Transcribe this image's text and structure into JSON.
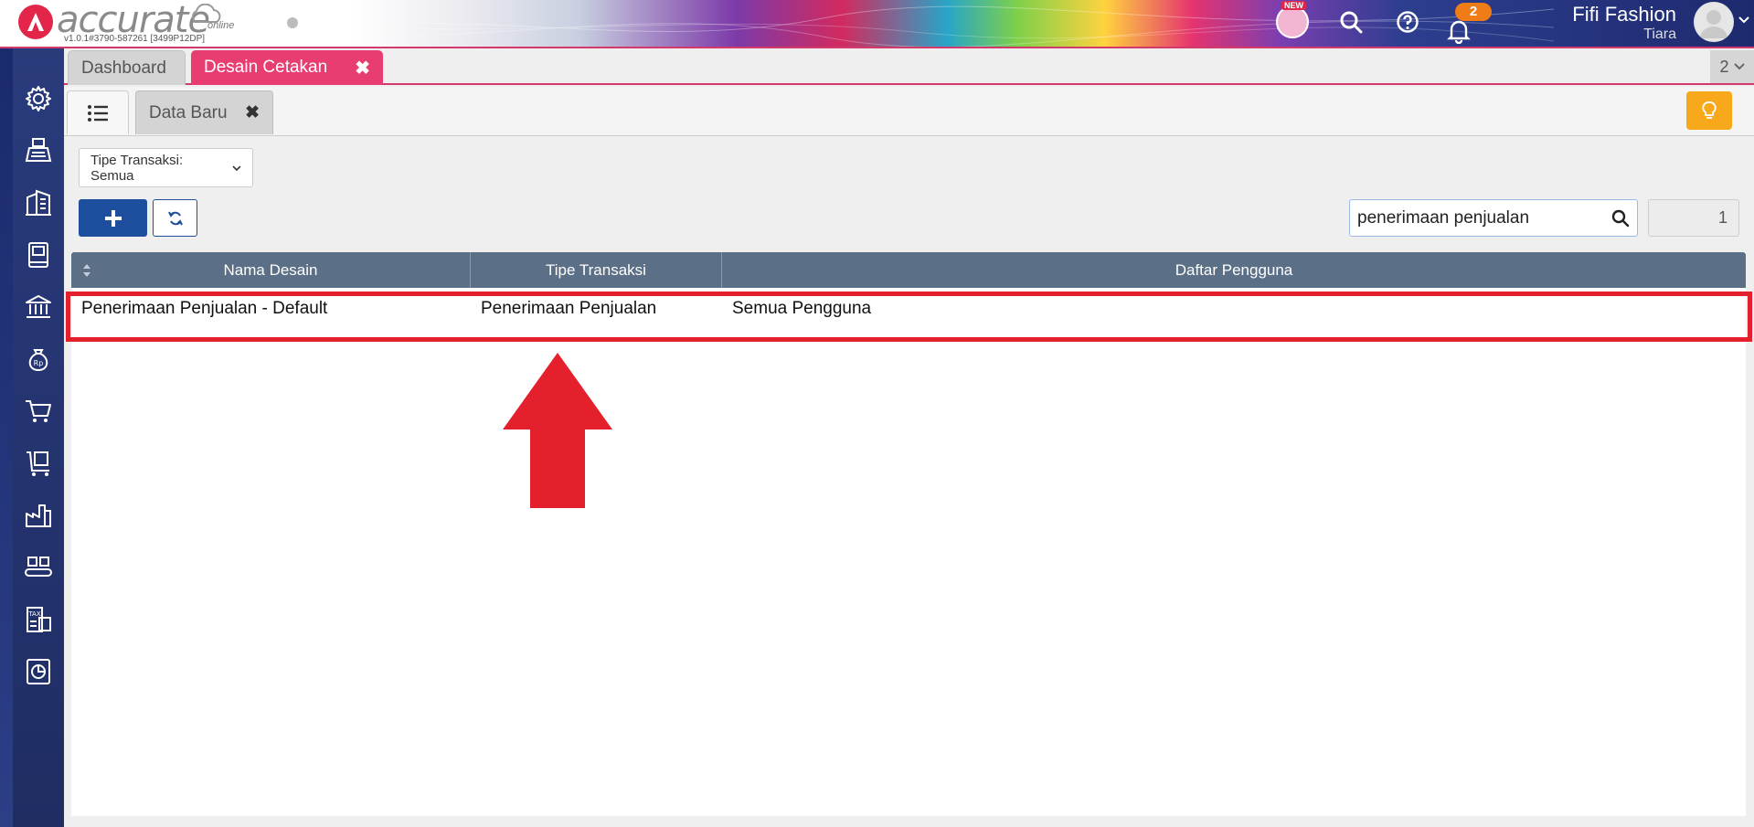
{
  "header": {
    "logo_text": "accurate",
    "logo_suffix": "online",
    "version": "v1.0.1#3790-587261 [3499P12DP]",
    "new_badge": "NEW",
    "notification_count": "2",
    "company_name": "Fifi Fashion",
    "user_name": "Tiara"
  },
  "tabs": [
    {
      "label": "Dashboard"
    },
    {
      "label": "Desain Cetakan",
      "active": true,
      "close": "✖"
    }
  ],
  "tab_count": "2",
  "subtab": {
    "label": "Data Baru",
    "close": "✖"
  },
  "filter": {
    "label": "Tipe Transaksi: Semua"
  },
  "search": {
    "value": "penerimaan penjualan",
    "placeholder": ""
  },
  "page_number": "1",
  "table": {
    "columns": [
      "Nama Desain",
      "Tipe Transaksi",
      "Daftar Pengguna"
    ],
    "rows": [
      [
        "Penerimaan Penjualan - Default",
        "Penerimaan Penjualan",
        "Semua Pengguna"
      ]
    ]
  },
  "sidebar": {
    "icons": [
      "gear-icon",
      "cash-register-icon",
      "building-icon",
      "ledger-book-icon",
      "bank-icon",
      "money-bag-icon",
      "shopping-cart-icon",
      "warehouse-cart-icon",
      "factory-icon",
      "conveyor-icon",
      "tax-icon",
      "report-chart-icon"
    ]
  },
  "colors": {
    "active_tab": "#e73d70",
    "primary_button": "#1e4f9e",
    "table_header": "#5b6f87",
    "highlight": "#e3202c",
    "notification": "#f07c16",
    "bulb_button": "#f7a81b"
  }
}
